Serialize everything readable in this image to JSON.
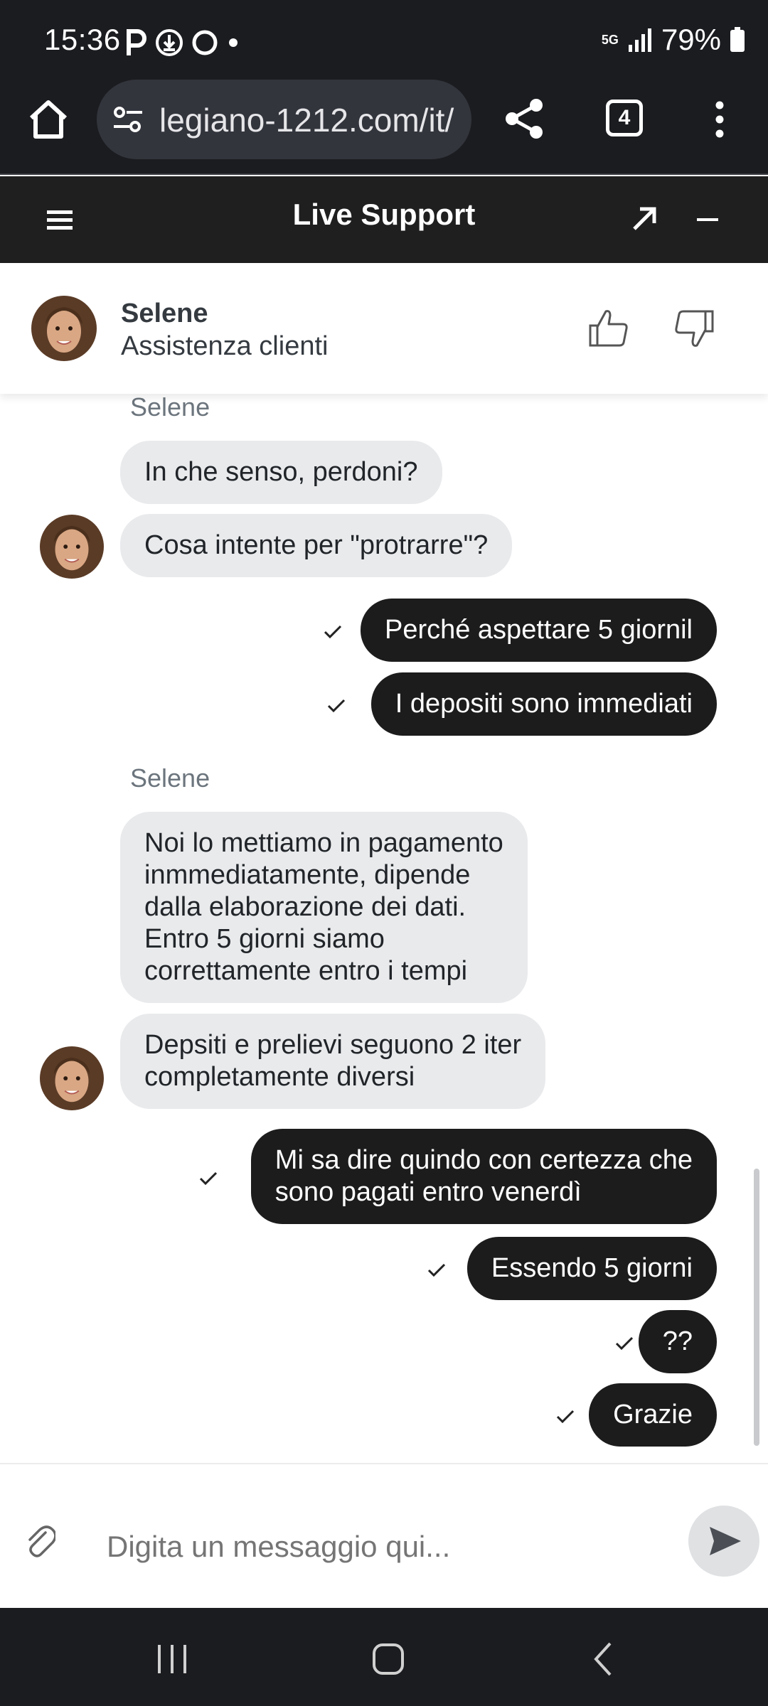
{
  "status_bar": {
    "time": "15:36",
    "network": "5G",
    "battery": "79%",
    "icons": [
      "parking-p-icon",
      "download-circle-icon",
      "circle-icon",
      "dot-icon",
      "signal-icon",
      "battery-icon"
    ]
  },
  "browser": {
    "url": "legiano-1212.com/it/",
    "tab_count": "4",
    "icons": [
      "home-icon",
      "site-settings-icon",
      "share-icon",
      "tabs-icon",
      "more-vert-icon"
    ]
  },
  "chat_header": {
    "title": "Live Support",
    "icons": [
      "menu-icon",
      "expand-arrow-icon",
      "minimize-icon"
    ]
  },
  "agent": {
    "name": "Selene",
    "role": "Assistenza clienti",
    "icons": [
      "thumbs-up-icon",
      "thumbs-down-icon"
    ]
  },
  "messages": [
    {
      "type": "label",
      "text": "Selene"
    },
    {
      "type": "agent",
      "text": "In che senso, perdoni?"
    },
    {
      "type": "agent",
      "text": "Cosa intente per \"protrarre\"?",
      "avatar": true
    },
    {
      "type": "user",
      "text": "Perché aspettare 5 giornil",
      "read": true
    },
    {
      "type": "user",
      "text": "I depositi sono immediati",
      "read": true
    },
    {
      "type": "label",
      "text": "Selene"
    },
    {
      "type": "agent",
      "lines": [
        "Noi lo mettiamo in pagamento",
        "inmmediatamente, dipende",
        "dalla elaborazione dei dati.",
        "Entro 5 giorni siamo",
        "correttamente entro i tempi"
      ]
    },
    {
      "type": "agent",
      "lines": [
        "Depsiti e prelievi seguono 2 iter",
        "completamente diversi"
      ],
      "avatar": true
    },
    {
      "type": "user",
      "lines": [
        "Mi sa dire quindo con certezza che",
        "sono pagati entro venerdì"
      ],
      "read": true
    },
    {
      "type": "user",
      "text": "Essendo 5 giorni",
      "read": true
    },
    {
      "type": "user",
      "text": "??",
      "read": true
    },
    {
      "type": "user",
      "text": "Grazie",
      "read": true
    }
  ],
  "composer": {
    "placeholder": "Digita un messaggio qui...",
    "icons": [
      "paperclip-icon",
      "send-icon"
    ]
  },
  "nav_bar": {
    "icons": [
      "recent-apps-icon",
      "home-button-icon",
      "back-icon"
    ]
  },
  "colors": {
    "dark_bar": "#1b1c20",
    "header": "#1f1f1f",
    "agent_bubble": "#e9eaec",
    "user_bubble": "#1c1c1c"
  }
}
